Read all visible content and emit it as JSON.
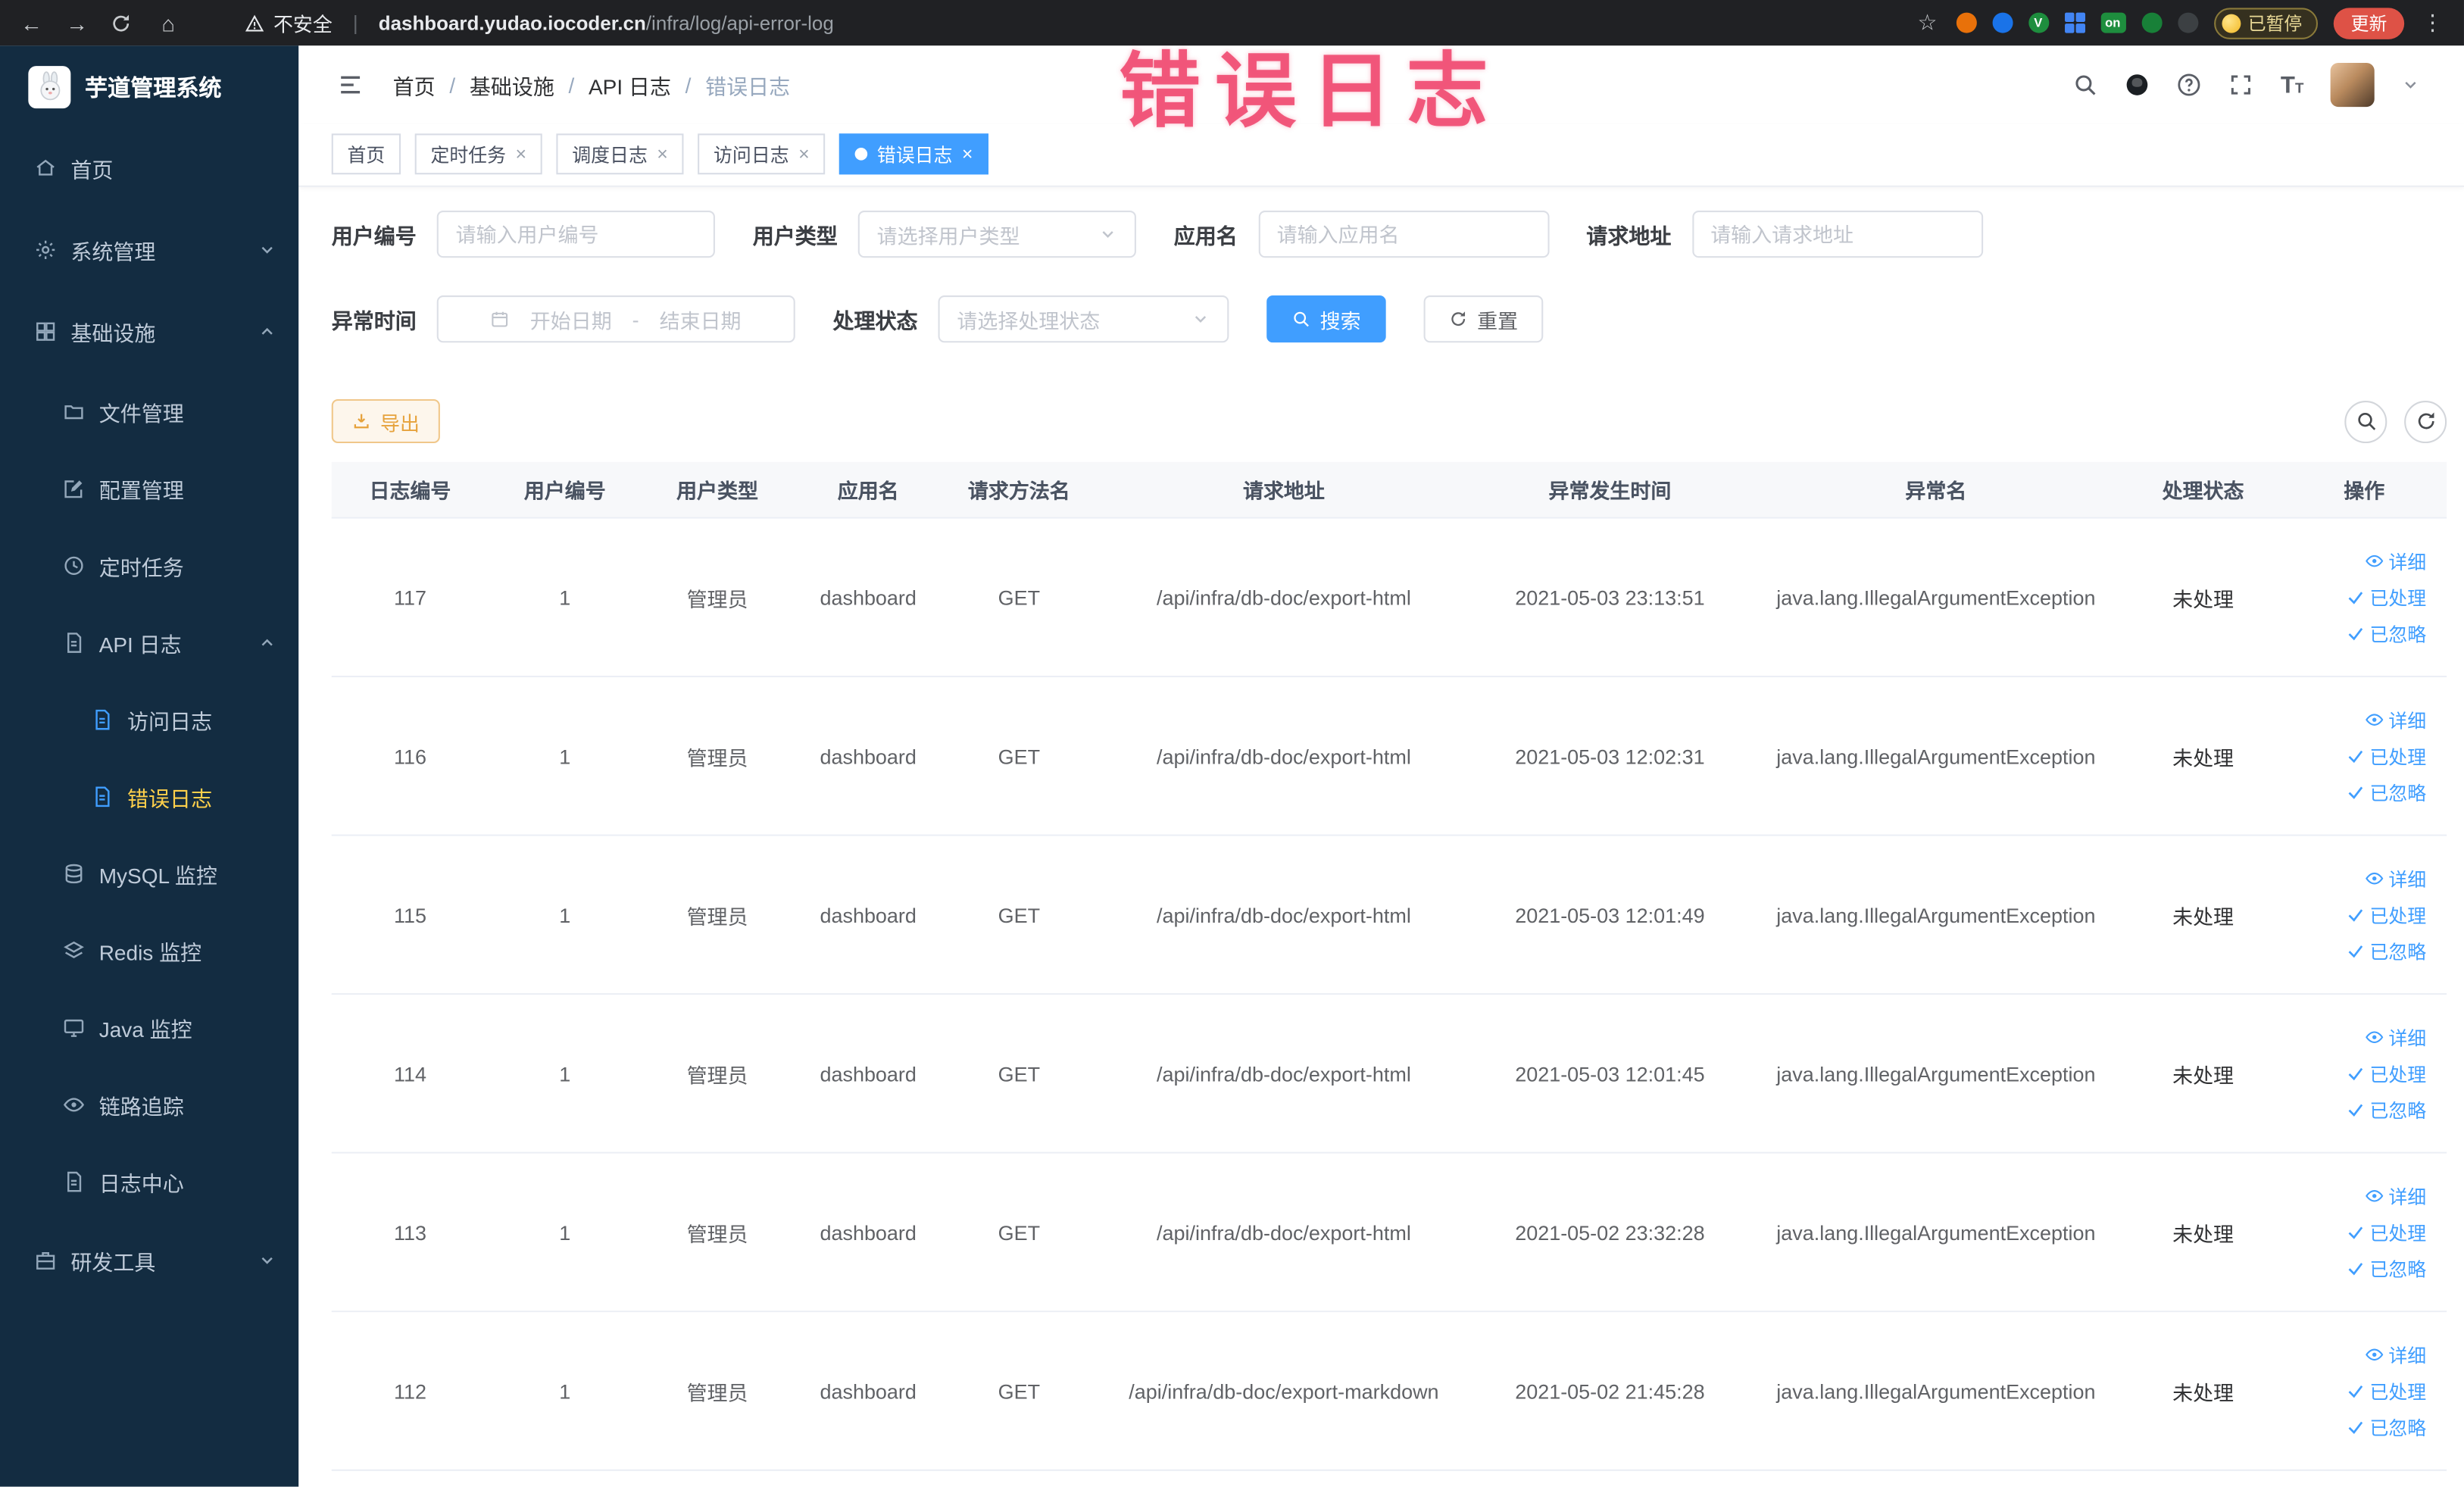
{
  "browser": {
    "security_label": "不安全",
    "url": {
      "domain": "dashboard.yudao.iocoder.cn",
      "path": "/infra/log/api-error-log"
    },
    "extensions": {
      "on_badge": "on",
      "v_badge": "V"
    },
    "paused_badge": "已暂停",
    "update_button": "更新",
    "menu_icon": "⋮"
  },
  "annotation": {
    "text": "错误日志"
  },
  "sidebar": {
    "title": "芋道管理系统",
    "items": [
      "首页",
      "系统管理",
      "基础设施",
      "文件管理",
      "配置管理",
      "定时任务",
      "API 日志",
      "访问日志",
      "错误日志",
      "MySQL 监控",
      "Redis 监控",
      "Java 监控",
      "链路追踪",
      "日志中心",
      "研发工具"
    ]
  },
  "breadcrumb": {
    "items": [
      "首页",
      "基础设施",
      "API 日志",
      "错误日志"
    ]
  },
  "tabs": [
    {
      "label": "首页"
    },
    {
      "label": "定时任务"
    },
    {
      "label": "调度日志"
    },
    {
      "label": "访问日志"
    },
    {
      "label": "错误日志"
    }
  ],
  "filters": {
    "user_id": {
      "label": "用户编号",
      "placeholder": "请输入用户编号"
    },
    "user_type": {
      "label": "用户类型",
      "placeholder": "请选择用户类型"
    },
    "app_name": {
      "label": "应用名",
      "placeholder": "请输入应用名"
    },
    "request_url": {
      "label": "请求地址",
      "placeholder": "请输入请求地址"
    },
    "exception_time": {
      "label": "异常时间",
      "start_placeholder": "开始日期",
      "separator": "-",
      "end_placeholder": "结束日期"
    },
    "process_status": {
      "label": "处理状态",
      "placeholder": "请选择处理状态"
    },
    "search_button": "搜索",
    "reset_button": "重置"
  },
  "toolbar": {
    "export_button": "导出"
  },
  "table": {
    "columns": [
      "日志编号",
      "用户编号",
      "用户类型",
      "应用名",
      "请求方法名",
      "请求地址",
      "异常发生时间",
      "异常名",
      "处理状态",
      "操作"
    ],
    "actions": {
      "detail": "详细",
      "processed": "已处理",
      "ignore": "已忽略"
    },
    "rows": [
      {
        "id": "117",
        "user_id": "1",
        "user_type": "管理员",
        "app_name": "dashboard",
        "method": "GET",
        "url": "/api/infra/db-doc/export-html",
        "time": "2021-05-03 23:13:51",
        "exception": "java.lang.IllegalArgumentException",
        "status": "未处理"
      },
      {
        "id": "116",
        "user_id": "1",
        "user_type": "管理员",
        "app_name": "dashboard",
        "method": "GET",
        "url": "/api/infra/db-doc/export-html",
        "time": "2021-05-03 12:02:31",
        "exception": "java.lang.IllegalArgumentException",
        "status": "未处理"
      },
      {
        "id": "115",
        "user_id": "1",
        "user_type": "管理员",
        "app_name": "dashboard",
        "method": "GET",
        "url": "/api/infra/db-doc/export-html",
        "time": "2021-05-03 12:01:49",
        "exception": "java.lang.IllegalArgumentException",
        "status": "未处理"
      },
      {
        "id": "114",
        "user_id": "1",
        "user_type": "管理员",
        "app_name": "dashboard",
        "method": "GET",
        "url": "/api/infra/db-doc/export-html",
        "time": "2021-05-03 12:01:45",
        "exception": "java.lang.IllegalArgumentException",
        "status": "未处理"
      },
      {
        "id": "113",
        "user_id": "1",
        "user_type": "管理员",
        "app_name": "dashboard",
        "method": "GET",
        "url": "/api/infra/db-doc/export-html",
        "time": "2021-05-02 23:32:28",
        "exception": "java.lang.IllegalArgumentException",
        "status": "未处理"
      },
      {
        "id": "112",
        "user_id": "1",
        "user_type": "管理员",
        "app_name": "dashboard",
        "method": "GET",
        "url": "/api/infra/db-doc/export-markdown",
        "time": "2021-05-02 21:45:28",
        "exception": "java.lang.IllegalArgumentException",
        "status": "未处理"
      }
    ]
  }
}
